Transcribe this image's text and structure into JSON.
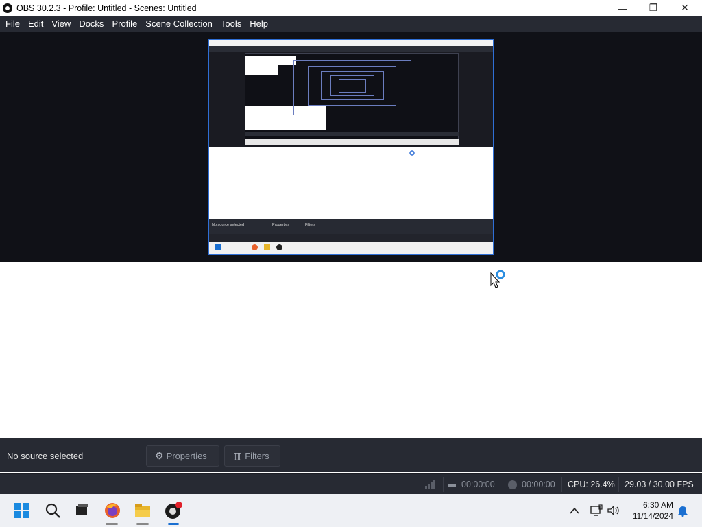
{
  "window": {
    "title": "OBS 30.2.3 - Profile: Untitled - Scenes: Untitled",
    "minimize": "—",
    "maximize": "❐",
    "close": "✕"
  },
  "menu": {
    "items": [
      "File",
      "Edit",
      "View",
      "Docks",
      "Profile",
      "Scene Collection",
      "Tools",
      "Help"
    ]
  },
  "preview": {
    "nested_status_text": "No source selected",
    "nested_properties": "Properties",
    "nested_filters": "Filters"
  },
  "context": {
    "no_source_label": "No source selected",
    "properties_label": "Properties",
    "filters_label": "Filters"
  },
  "status": {
    "stream_time": "00:00:00",
    "record_time": "00:00:00",
    "cpu": "CPU: 26.4%",
    "fps": "29.03 / 30.00 FPS"
  },
  "taskbar": {
    "icons": [
      "windows-start-icon",
      "search-icon",
      "task-view-icon",
      "firefox-icon",
      "file-explorer-icon",
      "obs-icon"
    ],
    "clock_time": "6:30 AM",
    "clock_date": "11/14/2024"
  },
  "colors": {
    "menu_bg": "#272a33",
    "preview_bg": "#101117",
    "selection_border": "#2f6fd6",
    "taskbar_bg": "#eef0f4"
  }
}
